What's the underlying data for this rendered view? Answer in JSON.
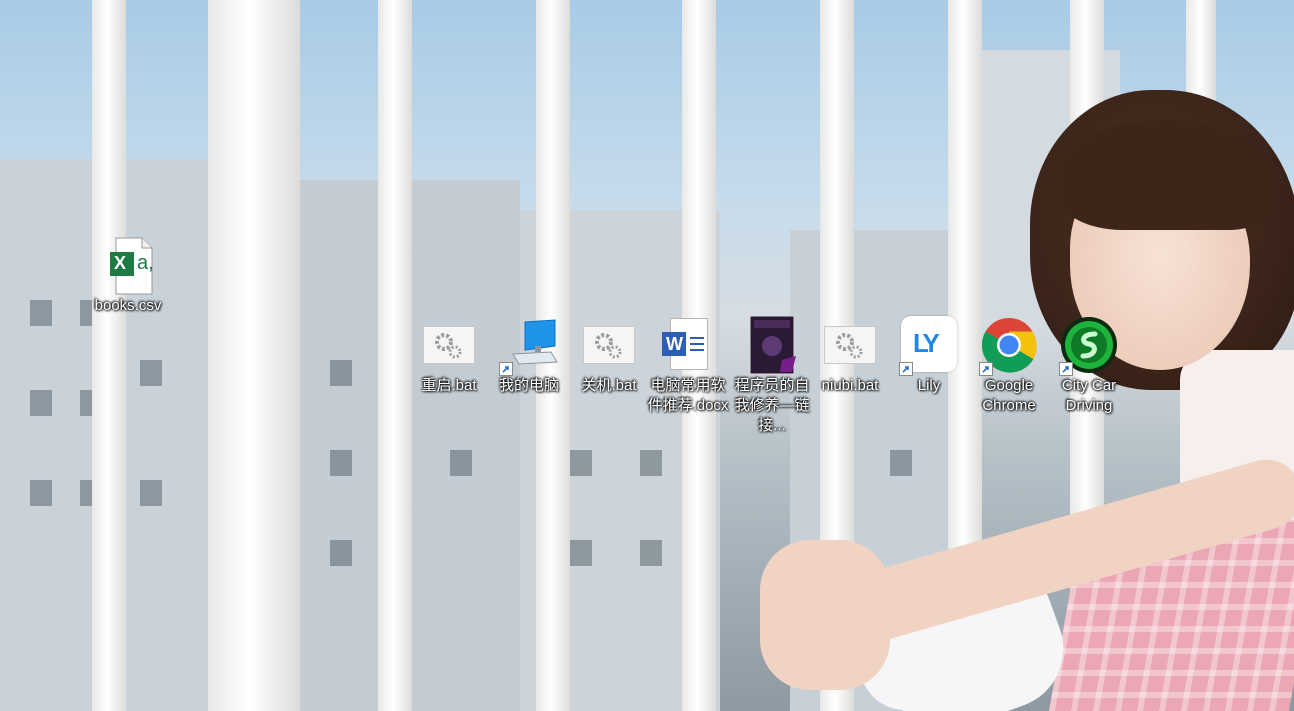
{
  "desktop": {
    "icons": [
      {
        "label": "books.csv",
        "kind": "csv"
      },
      {
        "label": "重启.bat",
        "kind": "bat"
      },
      {
        "label": "我的电脑",
        "kind": "computer"
      },
      {
        "label": "关机.bat",
        "kind": "bat"
      },
      {
        "label": "电脑常用软件推荐.docx",
        "kind": "word"
      },
      {
        "label": "程序员的自我修养—链接...",
        "kind": "book"
      },
      {
        "label": "niubi.bat",
        "kind": "bat"
      },
      {
        "label": "Lily",
        "kind": "lily",
        "glyph_text": "LY"
      },
      {
        "label": "Google Chrome",
        "kind": "chrome"
      },
      {
        "label": "City Car Driving",
        "kind": "citycar"
      }
    ],
    "csv_icon_text": "X",
    "csv_icon_sub": "a,",
    "word_icon_text": "W"
  },
  "colors": {
    "excel_green": "#1d7a45",
    "word_blue": "#2b5fb5",
    "chrome_red": "#db4437",
    "chrome_yellow": "#f4c20d",
    "chrome_green": "#0f9d58",
    "chrome_blue": "#4285f4",
    "lily_blue": "#1e88e5",
    "citycar_green": "#1db33c"
  }
}
